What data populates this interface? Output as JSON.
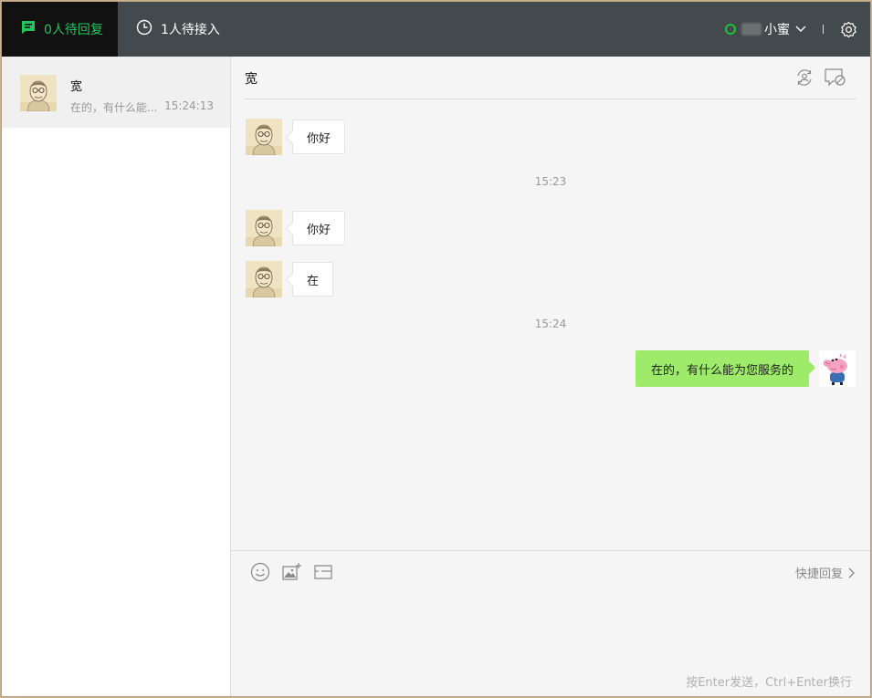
{
  "topbar": {
    "tab_pending_reply": "0人待回复",
    "tab_waiting_access": "1人待接入",
    "agent_name": "小蜜",
    "colors": {
      "active": "#22c55e",
      "online": "#1fbf3a"
    }
  },
  "conversation_list": [
    {
      "name": "宽",
      "preview": "在的，有什么能...",
      "time": "15:24:13"
    }
  ],
  "chat": {
    "title": "宽",
    "messages": [
      {
        "type": "in",
        "text": "你好"
      },
      {
        "type": "time",
        "text": "15:23"
      },
      {
        "type": "in",
        "text": "你好"
      },
      {
        "type": "in",
        "text": "在"
      },
      {
        "type": "time",
        "text": "15:24"
      },
      {
        "type": "out",
        "text": "在的，有什么能为您服务的"
      }
    ]
  },
  "composer": {
    "quick_reply": "快捷回复",
    "hint": "按Enter发送，Ctrl+Enter换行",
    "icons": [
      "emoji-icon",
      "image-icon",
      "screenshot-icon"
    ]
  }
}
